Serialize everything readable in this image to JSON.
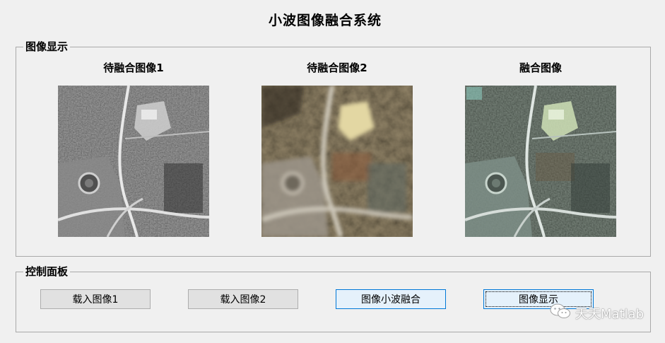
{
  "app": {
    "title": "小波图像融合系统"
  },
  "image_panel": {
    "legend": "图像显示",
    "images": [
      {
        "title": "待融合图像1"
      },
      {
        "title": "待融合图像2"
      },
      {
        "title": "融合图像"
      }
    ]
  },
  "control_panel": {
    "legend": "控制面板",
    "buttons": [
      {
        "label": "载入图像1"
      },
      {
        "label": "载入图像2"
      },
      {
        "label": "图像小波融合"
      },
      {
        "label": "图像显示"
      }
    ]
  },
  "watermark": {
    "text": "天天Matlab"
  }
}
